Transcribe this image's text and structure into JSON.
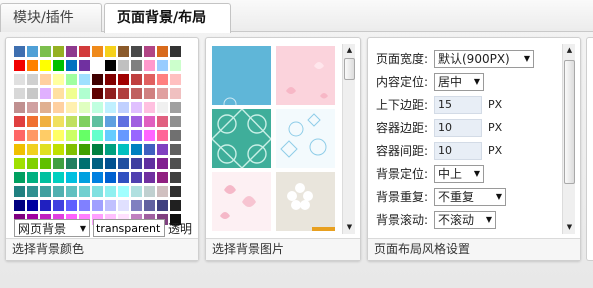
{
  "tabs": [
    {
      "label": "模块/插件",
      "active": false
    },
    {
      "label": "页面背景/布局",
      "active": true
    }
  ],
  "color_panel": {
    "title": "选择背景颜色",
    "palette_rows": [
      [
        "#3e6fb0",
        "#4fa0d6",
        "#7cbf4e",
        "#95b022",
        "#8e3a8e",
        "#d23b3b",
        "#ef8a1b",
        "#f6d11b",
        "#8b5a2b",
        "#4a4a4a",
        "#b14585",
        "#d86a1c",
        "#333333"
      ],
      [
        "#f20000",
        "#ff8000",
        "#ffff00",
        "#00c000",
        "#0070c0",
        "#7030a0",
        "#ffffff",
        "#000000",
        "#c0c0c0",
        "#808080",
        "#ff99cc",
        "#99ccff",
        "#ccffcc"
      ],
      [
        "#e0e0e0",
        "#d0d0d0",
        "#ffd0a0",
        "#ffffa0",
        "#a0ffa0",
        "#a0e0ff",
        "#400000",
        "#800000",
        "#a00000",
        "#c04040",
        "#e06060",
        "#ff8080",
        "#ffc0c0"
      ],
      [
        "#d8d8d8",
        "#c8c8c8",
        "#e0b0ff",
        "#ffe0a0",
        "#f0ff90",
        "#b0ffd0",
        "#600000",
        "#902020",
        "#b04040",
        "#c06060",
        "#d08080",
        "#e0a0a0",
        "#f0c0c0"
      ],
      [
        "#c09090",
        "#d0a0a0",
        "#e0b090",
        "#ffd0a0",
        "#fff0b0",
        "#e0ffc0",
        "#c0ffe0",
        "#c0f0ff",
        "#c0d0ff",
        "#e0c0ff",
        "#ffc0e0",
        "#f0f0f0",
        "#a0a0a0"
      ],
      [
        "#e04040",
        "#f07030",
        "#f0b040",
        "#f0e060",
        "#c0e060",
        "#80d060",
        "#60c0a0",
        "#60a0e0",
        "#6070e0",
        "#a060e0",
        "#e060c0",
        "#e06080",
        "#909090"
      ],
      [
        "#ff6666",
        "#ff9966",
        "#ffcc66",
        "#ffff66",
        "#ccff66",
        "#66ff66",
        "#66ffcc",
        "#66ccff",
        "#6699ff",
        "#9966ff",
        "#ff66ff",
        "#ff6699",
        "#707070"
      ],
      [
        "#f0c000",
        "#f0d020",
        "#e0e020",
        "#c0e000",
        "#80c000",
        "#40a000",
        "#008040",
        "#00a080",
        "#00c0c0",
        "#0080c0",
        "#4060c0",
        "#8040c0",
        "#606060"
      ],
      [
        "#a0e000",
        "#80d000",
        "#60c000",
        "#40a040",
        "#208060",
        "#007070",
        "#006080",
        "#005090",
        "#2050a0",
        "#4040a0",
        "#6030a0",
        "#802090",
        "#505050"
      ],
      [
        "#00a060",
        "#00b080",
        "#00c0a0",
        "#00d0c0",
        "#00c0e0",
        "#00a0e0",
        "#0080e0",
        "#0060d0",
        "#3050c0",
        "#5040b0",
        "#7030a0",
        "#902080",
        "#404040"
      ],
      [
        "#208080",
        "#309090",
        "#40a0a0",
        "#50b0b0",
        "#60c0c0",
        "#70d0d0",
        "#80e0e0",
        "#90f0f0",
        "#a0ffff",
        "#b0e0e0",
        "#c0d0d0",
        "#d0c0c0",
        "#303030"
      ],
      [
        "#000080",
        "#0000a0",
        "#2020c0",
        "#4040e0",
        "#6060ff",
        "#8080ff",
        "#a0a0ff",
        "#c0c0ff",
        "#e0e0ff",
        "#8080c0",
        "#6060a0",
        "#404080",
        "#202020"
      ],
      [
        "#800080",
        "#a000a0",
        "#c020c0",
        "#e040e0",
        "#ff60ff",
        "#ff80ff",
        "#ffa0ff",
        "#ffc0ff",
        "#ffe0ff",
        "#c080c0",
        "#a060a0",
        "#804080",
        "#101010"
      ]
    ],
    "bg_select_value": "网页背景",
    "color_value": "transparent",
    "transparent_label": "透明"
  },
  "image_panel": {
    "title": "选择背景图片",
    "thumbnails": [
      {
        "name": "blue-solid",
        "color": "#5fb6d8"
      },
      {
        "name": "pink-hearts",
        "color": "#fbd3dc"
      },
      {
        "name": "teal-pattern",
        "color": "#3fae9a"
      },
      {
        "name": "blue-lace",
        "color": "#e4f4fb"
      },
      {
        "name": "pink-hearts-big",
        "color": "#fbe4ea"
      },
      {
        "name": "flower-beige",
        "color": "#e9e5dc"
      }
    ]
  },
  "layout_panel": {
    "title": "页面布局风格设置",
    "fields": [
      {
        "key": "page_width",
        "label": "页面宽度:",
        "type": "select",
        "value": "默认(900PX)"
      },
      {
        "key": "content_align",
        "label": "内容定位:",
        "type": "select",
        "value": "居中"
      },
      {
        "key": "vertical_margin",
        "label": "上下边距:",
        "type": "number",
        "value": "15",
        "unit": "PX"
      },
      {
        "key": "container_margin",
        "label": "容器边距:",
        "type": "number",
        "value": "10",
        "unit": "PX"
      },
      {
        "key": "container_gap",
        "label": "容器间距:",
        "type": "number",
        "value": "10",
        "unit": "PX"
      },
      {
        "key": "bg_position",
        "label": "背景定位:",
        "type": "select",
        "value": "中上"
      },
      {
        "key": "bg_repeat",
        "label": "背景重复:",
        "type": "select",
        "value": "不重复"
      },
      {
        "key": "bg_scroll",
        "label": "背景滚动:",
        "type": "select",
        "value": "不滚动"
      }
    ]
  }
}
